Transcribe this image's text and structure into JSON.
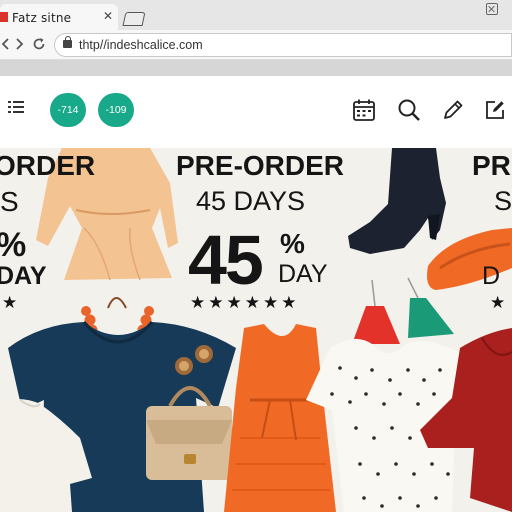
{
  "browser": {
    "tab_title": "Fatz sitne",
    "tab_close_glyph": "✕",
    "url": "thtp//indeshcalice.com"
  },
  "header": {
    "badges": [
      "-714",
      "-109"
    ]
  },
  "banner": {
    "left_fragments": [
      "ORDER",
      "S",
      "%",
      "DAY",
      "★"
    ],
    "center": {
      "line1": "PRE-ORDER",
      "line2": "45 DAYS",
      "big_number": "45",
      "percent": "%",
      "day": "DAY",
      "stars": "★★★★★★"
    },
    "right_fragments": [
      "PR",
      "S",
      "D",
      "★"
    ]
  },
  "icons": [
    "favicon-icon",
    "close-icon",
    "new-tab-icon",
    "window-close-icon",
    "back-icon",
    "forward-icon",
    "reload-icon",
    "lock-icon",
    "menu-icon",
    "calendar-icon",
    "search-icon",
    "edit-icon",
    "compose-icon"
  ],
  "colors": {
    "badge": "#18a98b",
    "favicon": "#d9342b",
    "banner_bg": "#f2f1ec",
    "dress_orange": "#f06a25",
    "top_navy": "#163a58",
    "blouse_peach": "#f4c392",
    "shirt_red": "#a9201e"
  }
}
